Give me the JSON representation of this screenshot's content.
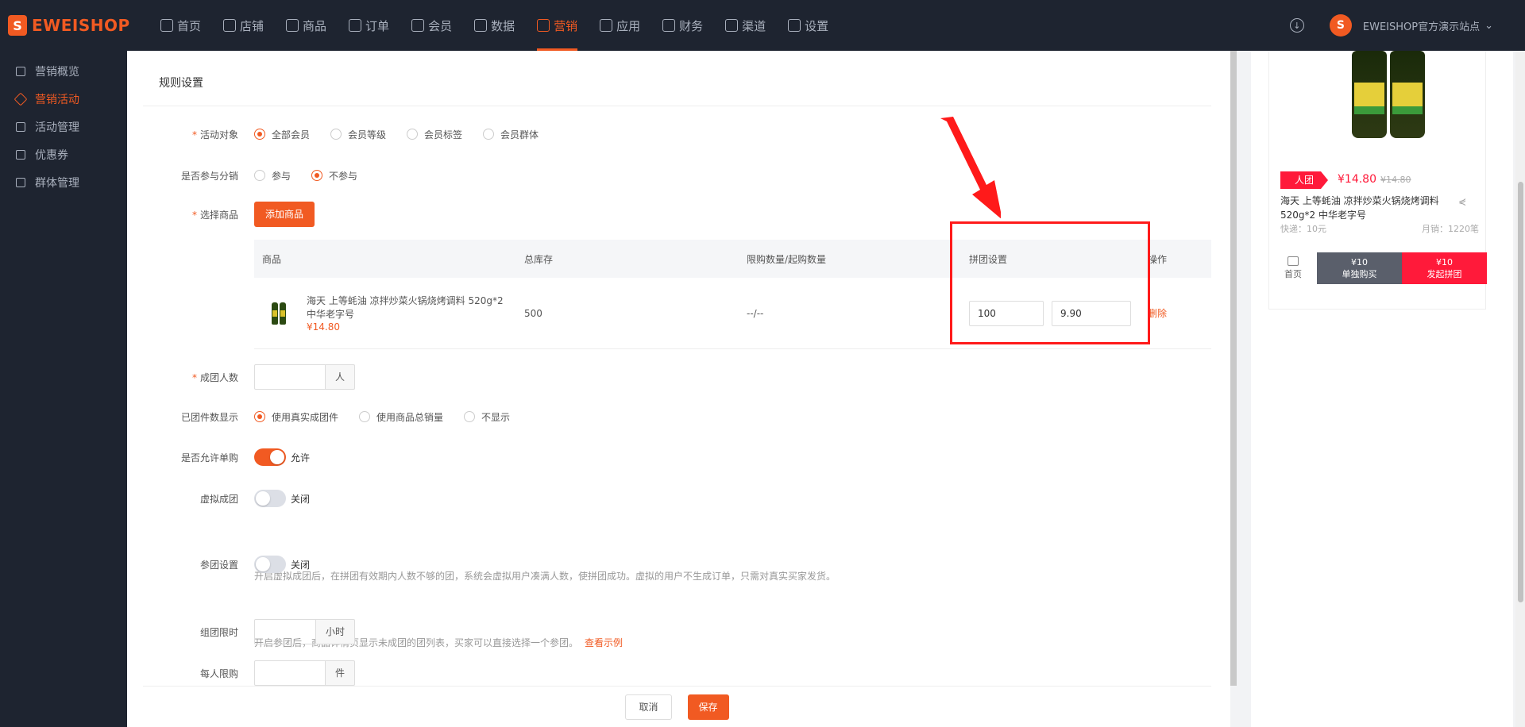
{
  "brand": {
    "name": "EWEISHOP",
    "mark": "S"
  },
  "nav": [
    {
      "label": "首页",
      "icon": "home-icon"
    },
    {
      "label": "店铺",
      "icon": "store-icon"
    },
    {
      "label": "商品",
      "icon": "goods-icon"
    },
    {
      "label": "订单",
      "icon": "order-icon"
    },
    {
      "label": "会员",
      "icon": "user-icon"
    },
    {
      "label": "数据",
      "icon": "chart-icon"
    },
    {
      "label": "营销",
      "icon": "tag-icon"
    },
    {
      "label": "应用",
      "icon": "app-icon"
    },
    {
      "label": "财务",
      "icon": "finance-icon"
    },
    {
      "label": "渠道",
      "icon": "channel-icon"
    },
    {
      "label": "设置",
      "icon": "gear-icon"
    }
  ],
  "nav_active": "营销",
  "user": {
    "site": "EWEISHOP官方演示站点",
    "chevron": "⌄",
    "download": "↓"
  },
  "sidebar": [
    {
      "label": "营销概览",
      "active": false
    },
    {
      "label": "营销活动",
      "active": true
    },
    {
      "label": "活动管理",
      "active": false
    },
    {
      "label": "优惠券",
      "active": false
    },
    {
      "label": "群体管理",
      "active": false
    }
  ],
  "section_title": "规则设置",
  "form": {
    "target": {
      "label": "活动对象",
      "options": [
        "全部会员",
        "会员等级",
        "会员标签",
        "会员群体"
      ],
      "selected": 0
    },
    "distribution": {
      "label": "是否参与分销",
      "options": [
        "参与",
        "不参与"
      ],
      "selected": 1
    },
    "goods": {
      "label": "选择商品",
      "button": "添加商品"
    },
    "table": {
      "headers": [
        "商品",
        "总库存",
        "限购数量/起购数量",
        "拼团设置",
        "操作"
      ],
      "rows": [
        {
          "name": "海天 上等蚝油 凉拌炒菜火锅烧烤调料 520g*2 中华老字号",
          "price": "¥14.80",
          "stock": "500",
          "limit": "--/--",
          "group_size": "100",
          "group_price": "9.90",
          "action": "删除"
        }
      ]
    },
    "group_count": {
      "label": "成团人数",
      "value": "",
      "unit": "人"
    },
    "display": {
      "label": "已团件数显示",
      "options": [
        "使用真实成团件",
        "使用商品总销量",
        "不显示"
      ],
      "selected": 0
    },
    "single_buy": {
      "label": "是否允许单购",
      "state": "允许"
    },
    "virtual": {
      "label": "虚拟成团",
      "state": "关闭",
      "hint": "开启虚拟成团后，在拼团有效期内人数不够的团，系统会虚拟用户凑满人数，使拼团成功。虚拟的用户不生成订单，只需对真实买家发货。"
    },
    "join": {
      "label": "参团设置",
      "state": "关闭",
      "hint": "开启参团后，商品详情页显示未成团的团列表，买家可以直接选择一个参团。",
      "link": "查看示例"
    },
    "time_limit": {
      "label": "组团限时",
      "value": "",
      "unit": "小时"
    },
    "per_limit": {
      "label": "每人限购",
      "value": "",
      "unit": "件"
    }
  },
  "footer": {
    "cancel": "取消",
    "save": "保存"
  },
  "preview": {
    "badge": "人团",
    "price": "¥14.80",
    "old_price": "¥14.80",
    "title": "海天 上等蚝油 凉拌炒菜火锅烧烤调料 520g*2 中华老字号",
    "shipping": "快递：10元",
    "sales": "月销：1220笔",
    "home": "首页",
    "single_price": "¥10",
    "single_label": "单独购买",
    "group_price": "¥10",
    "group_label": "发起拼团"
  },
  "colors": {
    "accent": "#f15a22",
    "nav_bg": "#1e2430",
    "highlight": "#ff1a1a",
    "preview_red": "#ff1a3a"
  }
}
